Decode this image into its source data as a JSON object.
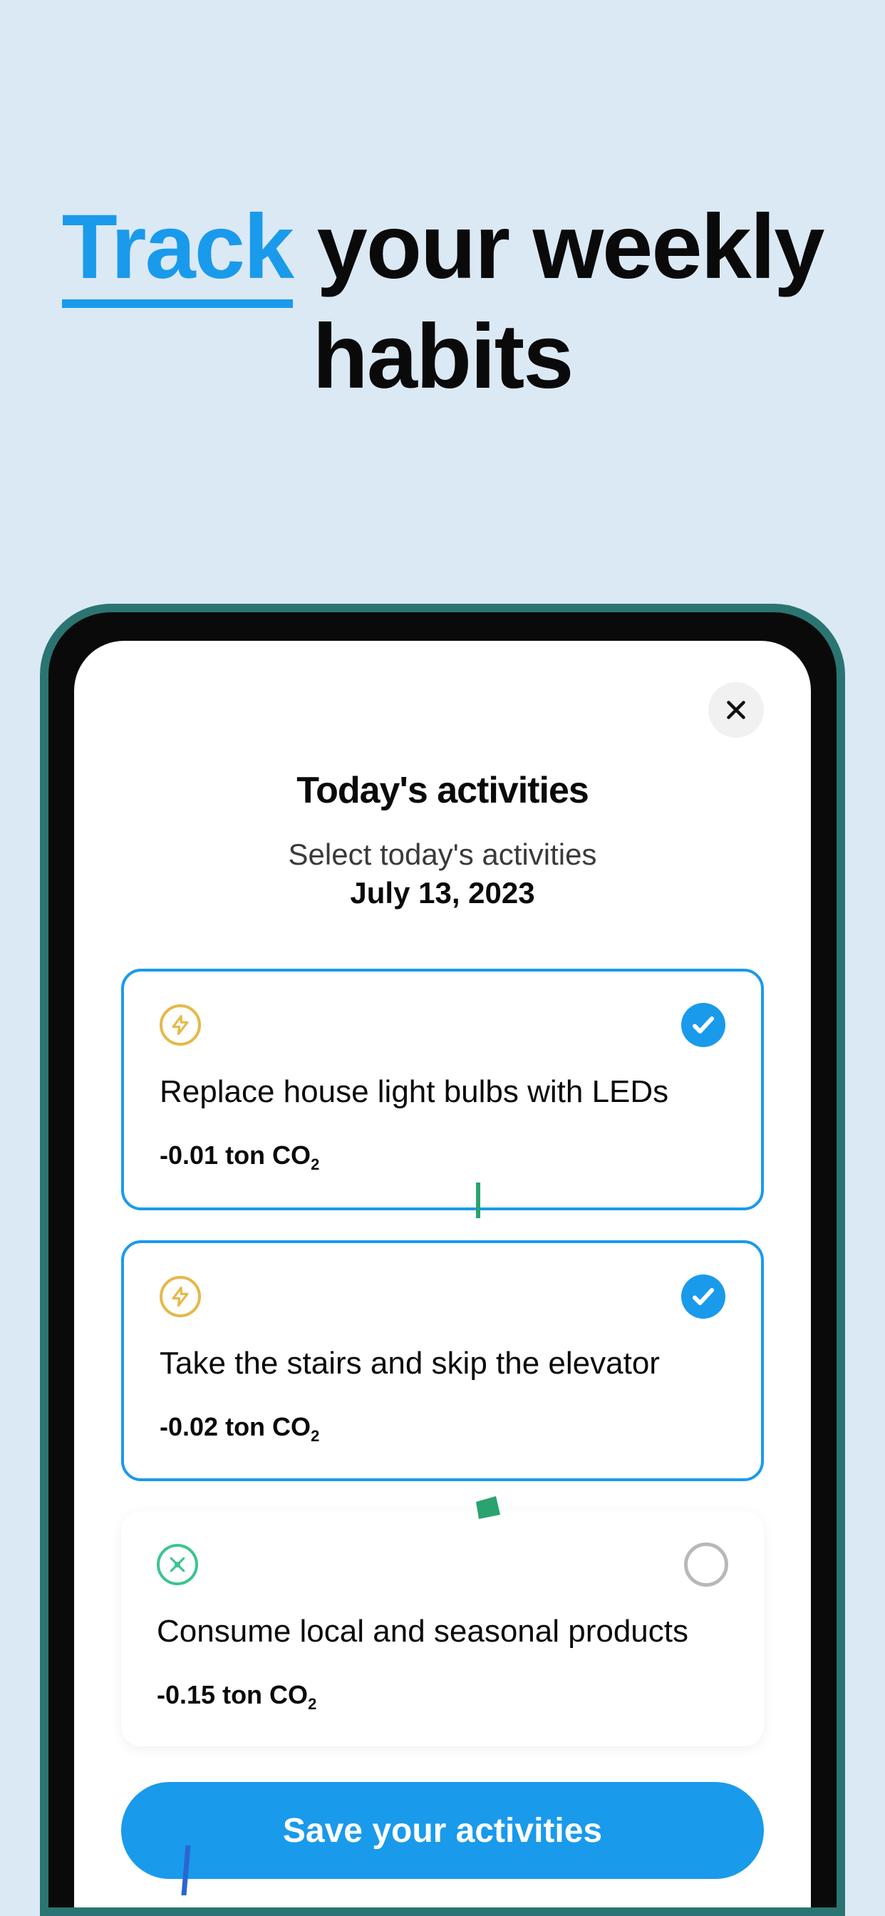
{
  "headline": {
    "highlight": "Track",
    "rest1": " your weekly",
    "rest2": "habits"
  },
  "modal": {
    "title": "Today's activities",
    "subtitle": "Select today's activities",
    "date": "July 13, 2023",
    "save_button_label": "Save your activities"
  },
  "activities": [
    {
      "category": "energy",
      "title": "Replace house light bulbs with LEDs",
      "impact_value": "-0.01",
      "impact_unit": "ton CO",
      "impact_sub": "2",
      "selected": true
    },
    {
      "category": "energy",
      "title": "Take the stairs and skip the elevator",
      "impact_value": "-0.02",
      "impact_unit": "ton CO",
      "impact_sub": "2",
      "selected": true
    },
    {
      "category": "food",
      "title": "Consume local and seasonal products",
      "impact_value": "-0.15",
      "impact_unit": "ton CO",
      "impact_sub": "2",
      "selected": false
    }
  ]
}
